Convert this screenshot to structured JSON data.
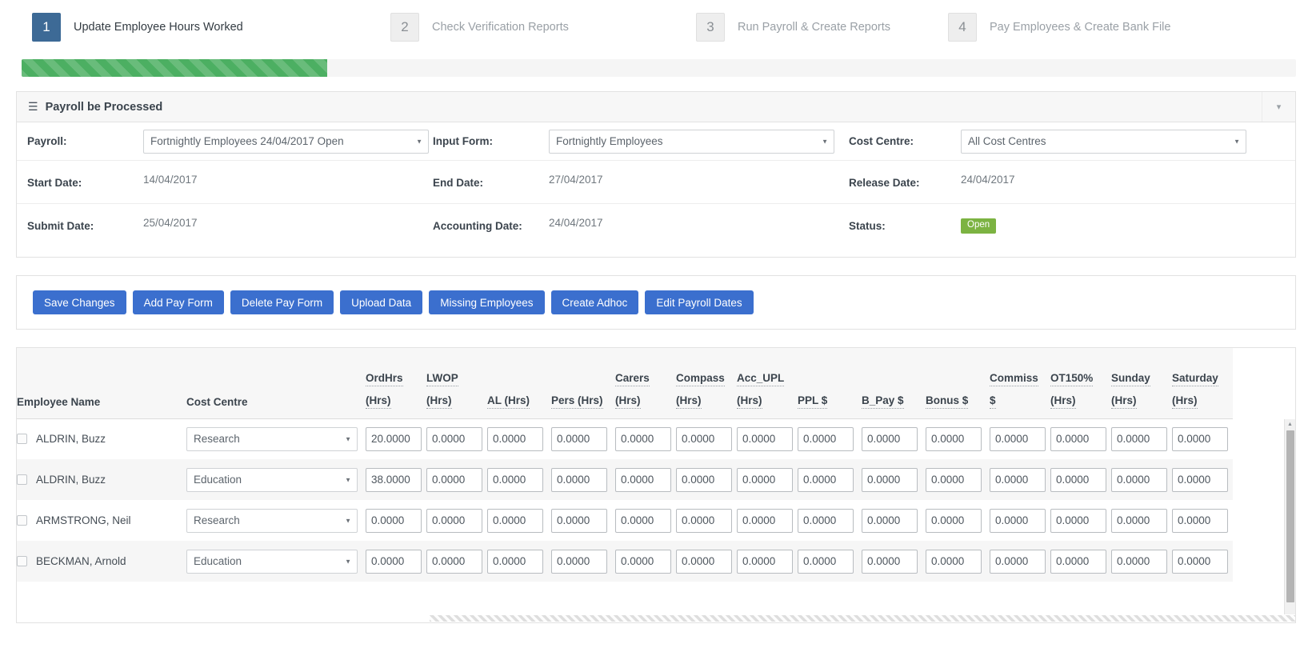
{
  "wizard": {
    "steps": [
      {
        "num": "1",
        "label": "Update Employee Hours Worked",
        "state": "active"
      },
      {
        "num": "2",
        "label": "Check Verification Reports",
        "state": "inactive"
      },
      {
        "num": "3",
        "label": "Run Payroll & Create Reports",
        "state": "inactive"
      },
      {
        "num": "4",
        "label": "Pay Employees & Create Bank File",
        "state": "inactive"
      }
    ],
    "progress_percent": 24,
    "progress_color": "#4caf62",
    "active_color": "#3d6a96"
  },
  "panel": {
    "title": "Payroll be Processed",
    "burger_icon": "hamburger-icon",
    "chevron_icon": "chevron-down-icon",
    "fields": {
      "payroll_label": "Payroll:",
      "payroll_value": "Fortnightly Employees 24/04/2017 Open",
      "input_form_label": "Input Form:",
      "input_form_value": "Fortnightly Employees",
      "cost_centre_label": "Cost Centre:",
      "cost_centre_value": "All Cost Centres",
      "start_date_label": "Start Date:",
      "start_date_value": "14/04/2017",
      "end_date_label": "End Date:",
      "end_date_value": "27/04/2017",
      "release_date_label": "Release Date:",
      "release_date_value": "24/04/2017",
      "submit_date_label": "Submit Date:",
      "submit_date_value": "25/04/2017",
      "accounting_date_label": "Accounting Date:",
      "accounting_date_value": "24/04/2017",
      "status_label": "Status:",
      "status_value": "Open",
      "status_color": "#7cb342"
    }
  },
  "toolbar": {
    "button_color": "#3b6fce",
    "buttons": [
      "Save Changes",
      "Add Pay Form",
      "Delete Pay Form",
      "Upload Data",
      "Missing Employees",
      "Create Adhoc",
      "Edit Payroll Dates"
    ]
  },
  "grid": {
    "columns": [
      {
        "key": "name",
        "top": "",
        "bottom": "Employee Name",
        "abbr": false,
        "type": "text"
      },
      {
        "key": "cc",
        "top": "",
        "bottom": "Cost Centre",
        "abbr": false,
        "type": "select"
      },
      {
        "key": "ordhrs",
        "top": "OrdHrs",
        "bottom": "(Hrs)",
        "abbr": true,
        "type": "num"
      },
      {
        "key": "lwop",
        "top": "LWOP",
        "bottom": "(Hrs)",
        "abbr": true,
        "type": "num"
      },
      {
        "key": "al",
        "top": "",
        "bottom": "AL (Hrs)",
        "abbr": true,
        "type": "num"
      },
      {
        "key": "pers",
        "top": "",
        "bottom": "Pers (Hrs)",
        "abbr": true,
        "type": "num"
      },
      {
        "key": "carers",
        "top": "Carers",
        "bottom": "(Hrs)",
        "abbr": true,
        "type": "num"
      },
      {
        "key": "compass",
        "top": "Compass",
        "bottom": "(Hrs)",
        "abbr": true,
        "type": "num"
      },
      {
        "key": "acc_upl",
        "top": "Acc_UPL",
        "bottom": "(Hrs)",
        "abbr": true,
        "type": "num"
      },
      {
        "key": "ppl",
        "top": "",
        "bottom": "PPL $",
        "abbr": true,
        "type": "num"
      },
      {
        "key": "b_pay",
        "top": "",
        "bottom": "B_Pay $",
        "abbr": true,
        "type": "num"
      },
      {
        "key": "bonus",
        "top": "",
        "bottom": "Bonus $",
        "abbr": true,
        "type": "num"
      },
      {
        "key": "commiss",
        "top": "Commiss",
        "bottom": "$",
        "abbr": true,
        "type": "num"
      },
      {
        "key": "ot150",
        "top": "OT150%",
        "bottom": "(Hrs)",
        "abbr": true,
        "type": "num"
      },
      {
        "key": "sunday",
        "top": "Sunday",
        "bottom": "(Hrs)",
        "abbr": true,
        "type": "num"
      },
      {
        "key": "saturday",
        "top": "Saturday",
        "bottom": "(Hrs)",
        "abbr": true,
        "type": "num"
      }
    ],
    "rows": [
      {
        "name": "ALDRIN, Buzz",
        "cost_centre": "Research",
        "selected": false,
        "values": [
          "20.0000",
          "0.0000",
          "0.0000",
          "0.0000",
          "0.0000",
          "0.0000",
          "0.0000",
          "0.0000",
          "0.0000",
          "0.0000",
          "0.0000",
          "0.0000",
          "0.0000",
          "0.0000"
        ]
      },
      {
        "name": "ALDRIN, Buzz",
        "cost_centre": "Education",
        "selected": false,
        "values": [
          "38.0000",
          "0.0000",
          "0.0000",
          "0.0000",
          "0.0000",
          "0.0000",
          "0.0000",
          "0.0000",
          "0.0000",
          "0.0000",
          "0.0000",
          "0.0000",
          "0.0000",
          "0.0000"
        ]
      },
      {
        "name": "ARMSTRONG, Neil",
        "cost_centre": "Research",
        "selected": false,
        "values": [
          "0.0000",
          "0.0000",
          "0.0000",
          "0.0000",
          "0.0000",
          "0.0000",
          "0.0000",
          "0.0000",
          "0.0000",
          "0.0000",
          "0.0000",
          "0.0000",
          "0.0000",
          "0.0000"
        ]
      },
      {
        "name": "BECKMAN, Arnold",
        "cost_centre": "Education",
        "selected": false,
        "values": [
          "0.0000",
          "0.0000",
          "0.0000",
          "0.0000",
          "0.0000",
          "0.0000",
          "0.0000",
          "0.0000",
          "0.0000",
          "0.0000",
          "0.0000",
          "0.0000",
          "0.0000",
          "0.0000"
        ]
      }
    ]
  }
}
